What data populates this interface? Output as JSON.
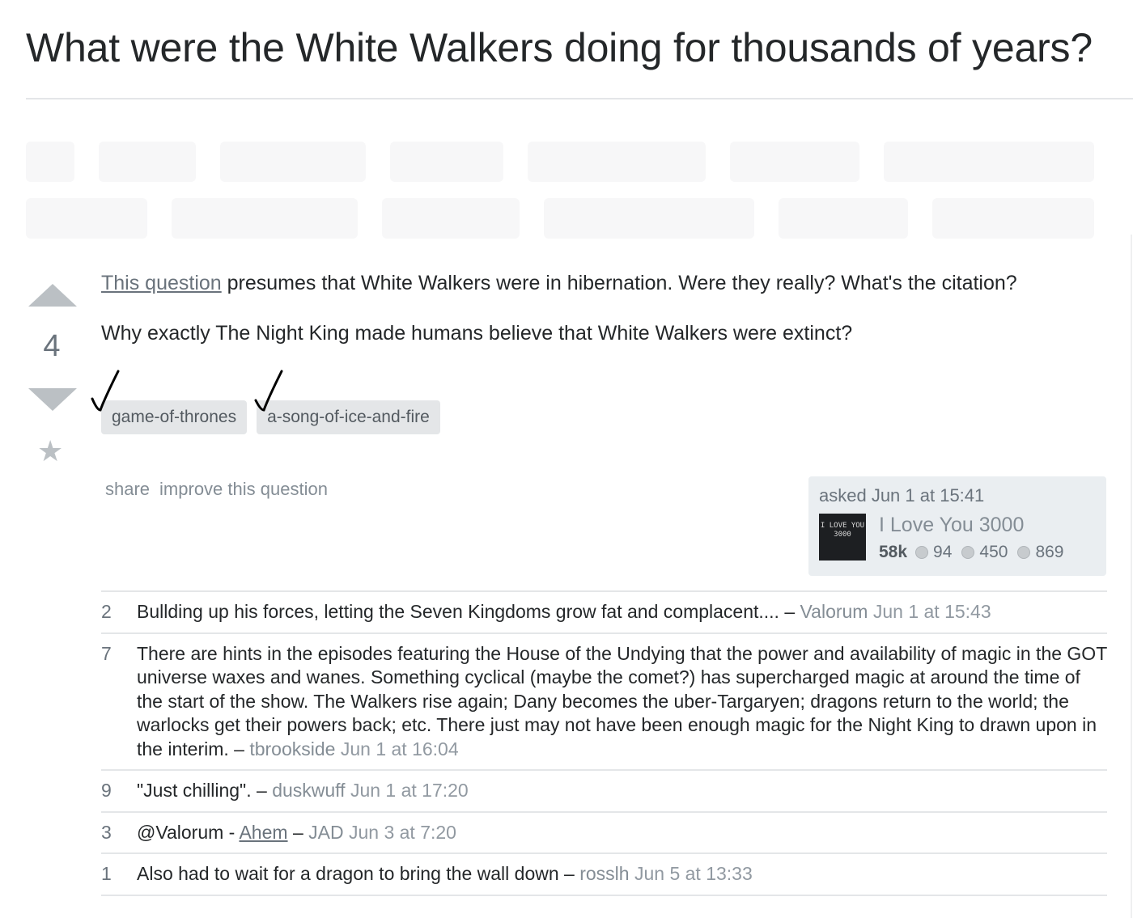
{
  "page_title": "What were the White Walkers doing for thousands of years?",
  "vote": {
    "count": "4"
  },
  "post": {
    "link_text": "This question",
    "paragraph1_rest": " presumes that White Walkers were in hibernation. Were they really? What's the citation?",
    "paragraph2": "Why exactly The Night King made humans believe that White Walkers were extinct?"
  },
  "tags": [
    "game-of-thrones",
    "a-song-of-ice-and-fire"
  ],
  "post_menu": {
    "share": "share",
    "improve": "improve this question"
  },
  "user_card": {
    "asked": "asked Jun 1 at 15:41",
    "name": "I Love You 3000",
    "avatar_text": "I LOVE YOU 3000",
    "reputation": "58k",
    "gold": "94",
    "silver": "450",
    "bronze": "869"
  },
  "comments": [
    {
      "score": "2",
      "text": "Bullding up his forces, letting the Seven Kingdoms grow fat and complacent.... – ",
      "user": "Valorum",
      "date": "Jun 1 at 15:43"
    },
    {
      "score": "7",
      "text": "There are hints in the episodes featuring the House of the Undying that the power and availability of magic in the GOT universe waxes and wanes. Something cyclical (maybe the comet?) has supercharged magic at around the time of the start of the show. The Walkers rise again; Dany becomes the uber-Targaryen; dragons return to the world; the warlocks get their powers back; etc. There just may not have been enough magic for the Night King to drawn upon in the interim. – ",
      "user": "tbrookside",
      "date": "Jun 1 at 16:04"
    },
    {
      "score": "9",
      "text": "\"Just chilling\". – ",
      "user": "duskwuff",
      "date": "Jun 1 at 17:20"
    },
    {
      "score": "3",
      "text_pre": "@Valorum - ",
      "link": "Ahem",
      "text_post": " – ",
      "user": "JAD",
      "date": "Jun 3 at 7:20"
    },
    {
      "score": "1",
      "text": "Also had to wait for a dragon to bring the wall down – ",
      "user": "rosslh",
      "date": "Jun 5 at 13:33"
    }
  ],
  "colors": {
    "text": "#242729",
    "muted": "#6a737c",
    "tag_bg": "#e4e6e8",
    "card_bg": "#eaeef1",
    "arrow": "#bbc0c4"
  }
}
